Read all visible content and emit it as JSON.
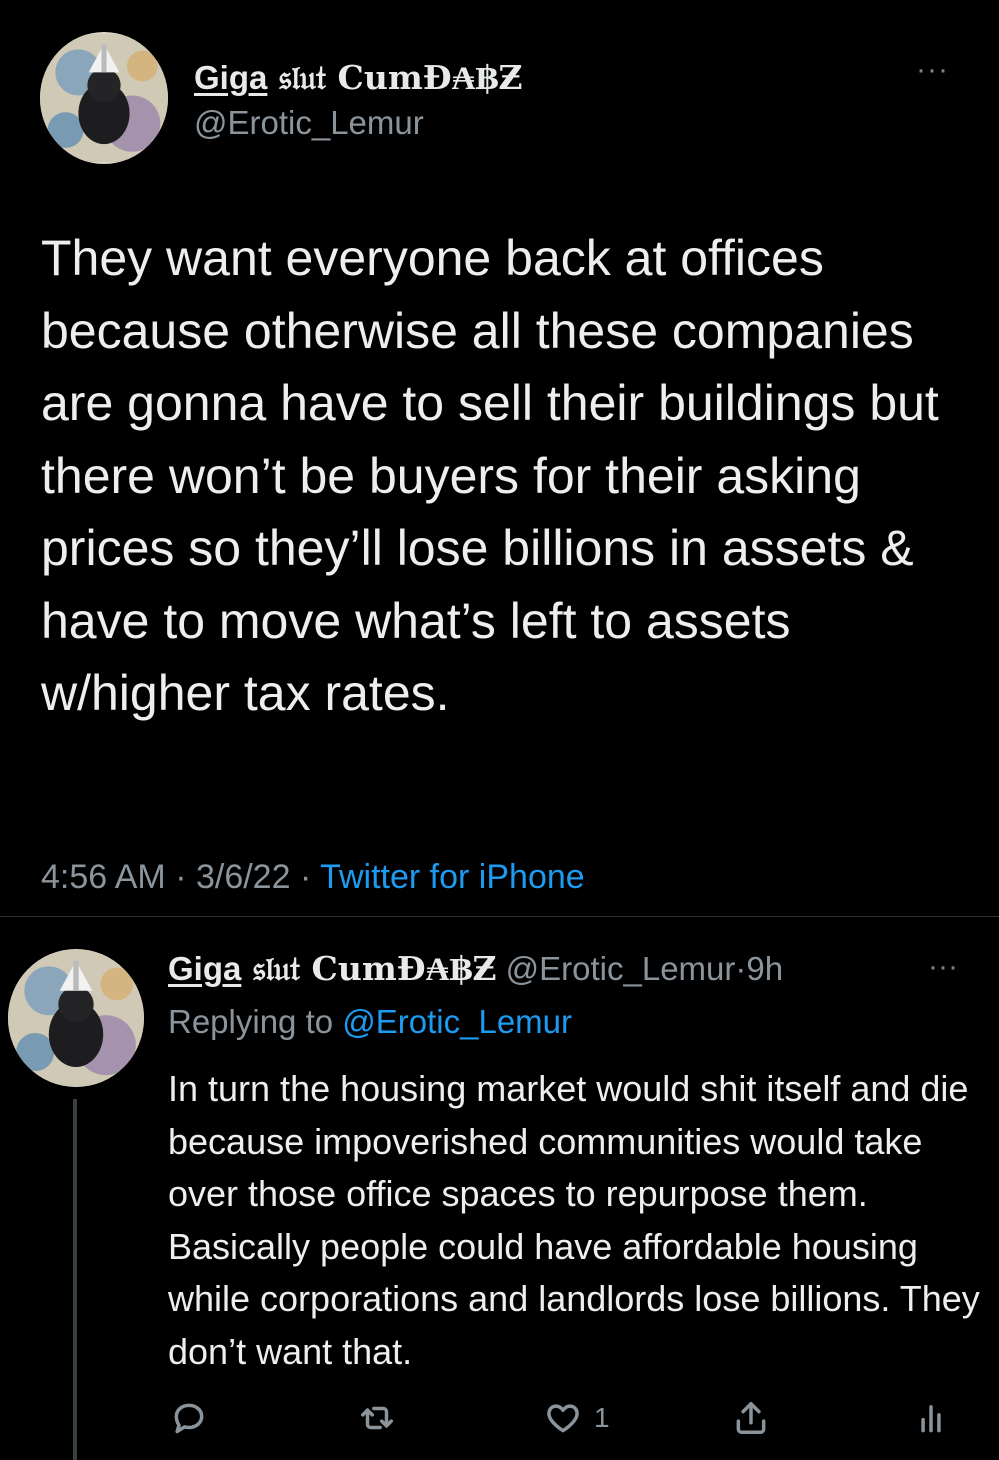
{
  "tweet": {
    "author": {
      "display_name_prefix": "Giga",
      "display_name_rest": " 𝔰𝔩𝔲𝔱 CumĐ₳฿Ƶ",
      "handle": "@Erotic_Lemur"
    },
    "more_label": "···",
    "text": "They want everyone back at offices because otherwise all these companies are gonna have to sell their buildings but there won’t be buyers for their asking prices so they’ll lose billions in assets & have to move what’s left to assets w/higher tax rates.",
    "time": "4:56 AM",
    "date": "3/6/22",
    "source": "Twitter for iPhone",
    "separator": " · "
  },
  "reply": {
    "author": {
      "display_name_prefix": "Giga",
      "display_name_rest": " 𝔰𝔩𝔲𝔱 CumĐ₳฿Ƶ",
      "handle": "@Erotic_Lemur",
      "age": "9h"
    },
    "more_label": "···",
    "replying_prefix": "Replying to ",
    "replying_to": "@Erotic_Lemur",
    "text": "In turn the housing market would shit itself and die because impoverished communities would take over those office spaces to repurpose them. Basically people could have affordable housing while corporations and landlords lose billions. They don’t want that.",
    "actions": {
      "like_count": "1"
    }
  },
  "icons": {
    "reply": "reply-icon",
    "retweet": "retweet-icon",
    "like": "heart-icon",
    "share": "share-icon",
    "stats": "analytics-icon"
  },
  "colors": {
    "background": "#000000",
    "text": "#e7e9ea",
    "secondary": "#8b949b",
    "link": "#1d9bf0"
  }
}
